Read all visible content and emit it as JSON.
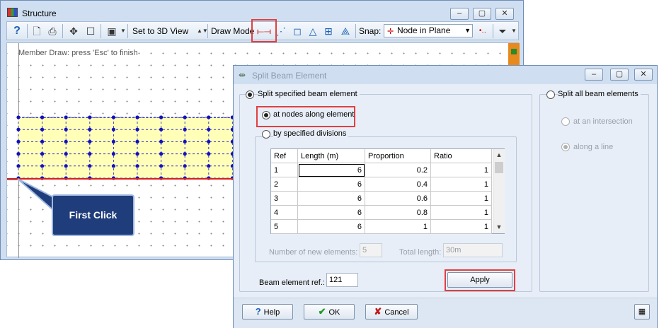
{
  "structure_window": {
    "title": "Structure",
    "toolbar": {
      "set_view_label": "Set to 3D View",
      "draw_mode_label": "Draw Mode",
      "snap_label": "Snap:",
      "snap_value": "Node in Plane"
    },
    "canvas_hint": "Member Draw: press 'Esc' to finish",
    "callout_text": "First Click"
  },
  "dialog": {
    "title": "Split Beam Element",
    "split_specified_label": "Split specified beam element",
    "at_nodes_label": "at nodes along element",
    "by_divisions_label": "by specified divisions",
    "split_all_label": "Split all beam elements",
    "at_intersection_label": "at an intersection",
    "along_line_label": "along a line",
    "table": {
      "columns": [
        "Ref",
        "Length (m)",
        "Proportion",
        "Ratio"
      ],
      "rows": [
        [
          "1",
          "6",
          "0.2",
          "1"
        ],
        [
          "2",
          "6",
          "0.4",
          "1"
        ],
        [
          "3",
          "6",
          "0.6",
          "1"
        ],
        [
          "4",
          "6",
          "0.8",
          "1"
        ],
        [
          "5",
          "6",
          "1",
          "1"
        ]
      ]
    },
    "new_elements_label": "Number of new elements:",
    "new_elements_value": "5",
    "total_length_label": "Total length:",
    "total_length_value": "30m",
    "beam_ref_label": "Beam element ref.:",
    "beam_ref_value": "121",
    "apply_label": "Apply",
    "help_label": "Help",
    "ok_label": "OK",
    "cancel_label": "Cancel"
  },
  "icons": [
    "help-icon",
    "print-preview-icon",
    "print-icon",
    "pan-icon",
    "select-box-icon",
    "save-icon",
    "draw-member-icon",
    "calculator-icon",
    "filter-icon"
  ],
  "colors": {
    "highlight": "#e04040",
    "callout": "#1f3d7a",
    "node": "#1010c0",
    "beam": "#d61f1f",
    "fill": "#ffffb8"
  }
}
